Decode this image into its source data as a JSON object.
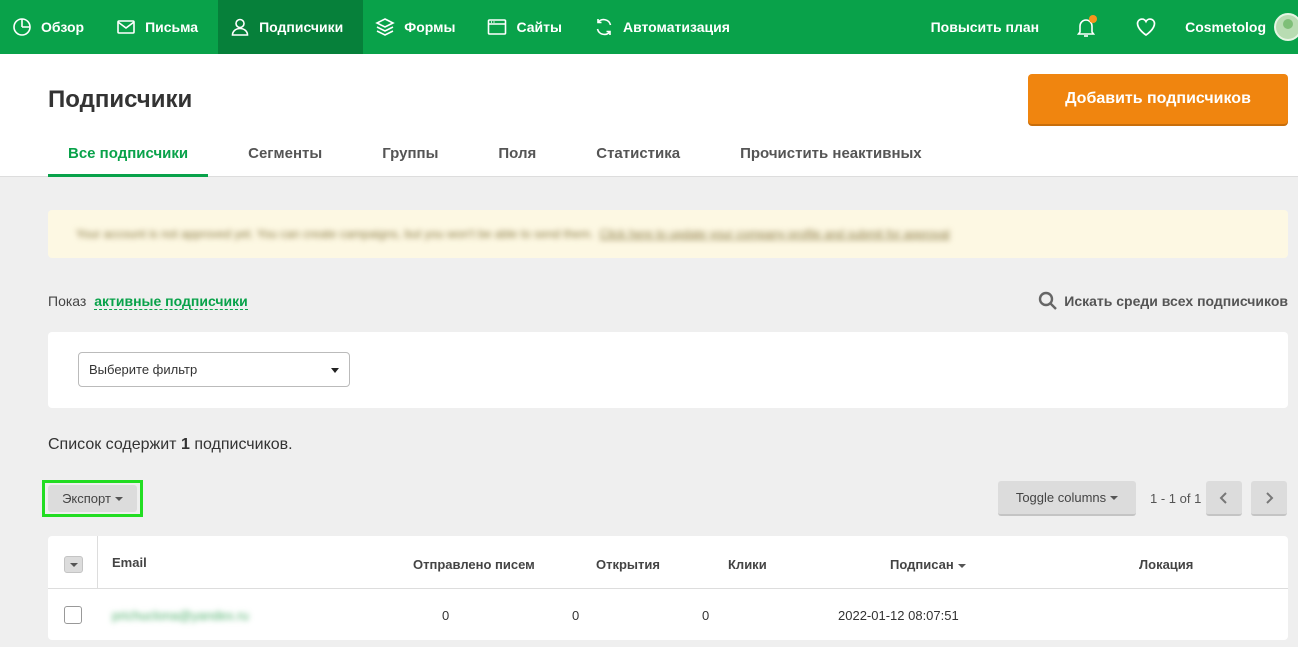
{
  "nav": {
    "items": [
      {
        "label": "Обзор",
        "icon": "dashboard-icon"
      },
      {
        "label": "Письма",
        "icon": "mail-icon"
      },
      {
        "label": "Подписчики",
        "icon": "user-icon",
        "active": true
      },
      {
        "label": "Формы",
        "icon": "layers-icon"
      },
      {
        "label": "Сайты",
        "icon": "browser-icon"
      },
      {
        "label": "Автоматизация",
        "icon": "refresh-icon"
      }
    ],
    "upgrade_label": "Повысить план",
    "account_name": "Cosmetolog"
  },
  "header": {
    "title": "Подписчики",
    "add_button": "Добавить подписчиков",
    "tabs": [
      {
        "label": "Все подписчики",
        "active": true
      },
      {
        "label": "Сегменты"
      },
      {
        "label": "Группы"
      },
      {
        "label": "Поля"
      },
      {
        "label": "Статистика"
      },
      {
        "label": "Прочистить неактивных"
      }
    ]
  },
  "notice": {
    "text": "Your account is not approved yet. You can create campaigns, but you won't be able to send them.",
    "link": "Click here to update your company profile and submit for approval"
  },
  "filter": {
    "showing_prefix": "Показ",
    "showing_link": "активные подписчики",
    "search_all": "Искать среди всех подписчиков",
    "select_value": "Выберите фильтр"
  },
  "summary": {
    "prefix": "Список содержит",
    "count": "1",
    "suffix": "подписчиков."
  },
  "toolbar": {
    "export": "Экспорт",
    "toggle_columns": "Toggle columns",
    "pager": "1 - 1 of 1"
  },
  "table": {
    "columns": {
      "email": "Email",
      "sent": "Отправлено писем",
      "opens": "Открытия",
      "clicks": "Клики",
      "subscribed": "Подписан",
      "location": "Локация"
    },
    "rows": [
      {
        "email": "prichuclona@yandex.ru",
        "sent": "0",
        "opens": "0",
        "clicks": "0",
        "subscribed": "2022-01-12 08:07:51",
        "location": ""
      }
    ]
  },
  "colors": {
    "brand_green": "#09a24a",
    "active_nav": "#06803a",
    "accent_orange": "#f0850f",
    "notice_bg": "#fdf8e3",
    "highlight_box": "#22dd22"
  }
}
